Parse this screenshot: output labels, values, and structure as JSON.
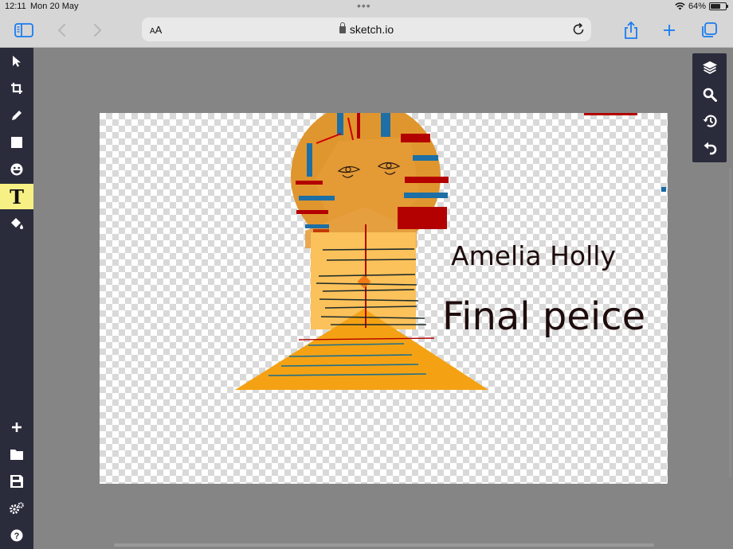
{
  "status": {
    "time": "12:11",
    "date": "Mon 20 May",
    "battery_percent": "64%",
    "battery_level": 0.64
  },
  "browser": {
    "text_size_label": "AA",
    "url": "sketch.io"
  },
  "tools": [
    {
      "name": "select",
      "icon": "cursor-icon"
    },
    {
      "name": "crop",
      "icon": "crop-icon"
    },
    {
      "name": "pencil",
      "icon": "pencil-icon"
    },
    {
      "name": "shape",
      "icon": "square-icon"
    },
    {
      "name": "sticker",
      "icon": "emoji-icon"
    },
    {
      "name": "text",
      "icon": "text-icon",
      "label": "T",
      "active": true
    },
    {
      "name": "fill",
      "icon": "paint-bucket-icon"
    }
  ],
  "bottom_tools": [
    {
      "name": "new",
      "icon": "plus-icon"
    },
    {
      "name": "open",
      "icon": "folder-icon"
    },
    {
      "name": "save",
      "icon": "save-icon"
    },
    {
      "name": "settings",
      "icon": "settings-icon"
    },
    {
      "name": "help",
      "icon": "help-icon"
    }
  ],
  "right_panel": [
    {
      "name": "layers",
      "icon": "layers-icon"
    },
    {
      "name": "zoom",
      "icon": "search-icon"
    },
    {
      "name": "history",
      "icon": "history-icon"
    },
    {
      "name": "undo",
      "icon": "undo-icon"
    }
  ],
  "canvas": {
    "text_name": "Amelia Holly",
    "text_title": "Final peice"
  },
  "colors": {
    "sidebar_bg": "#2a2c3c",
    "active_tool": "#f7f085",
    "accent_blue": "#1a7cf0",
    "art_orange": "#f4a214",
    "art_head": "#e0962e",
    "art_red": "#b30000",
    "art_blue": "#1d6fa5"
  }
}
